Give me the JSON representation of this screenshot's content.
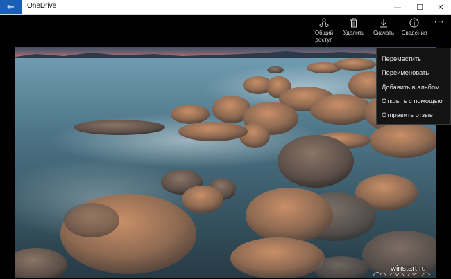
{
  "window": {
    "title": "OneDrive",
    "back_icon": "←",
    "minimize_icon": "—",
    "maximize_icon": "☐",
    "close_icon": "✕"
  },
  "toolbar": {
    "share_line1": "Общий",
    "share_line2": "доступ",
    "delete": "Удалить",
    "download": "Скачать",
    "info": "Сведения",
    "more": "···"
  },
  "menu": {
    "items": [
      "Переместить",
      "Переименовать",
      "Добавить в альбом",
      "Открыть с помощью",
      "Отправить отзыв"
    ]
  },
  "photo": {
    "watermark": "winstart.ru"
  }
}
